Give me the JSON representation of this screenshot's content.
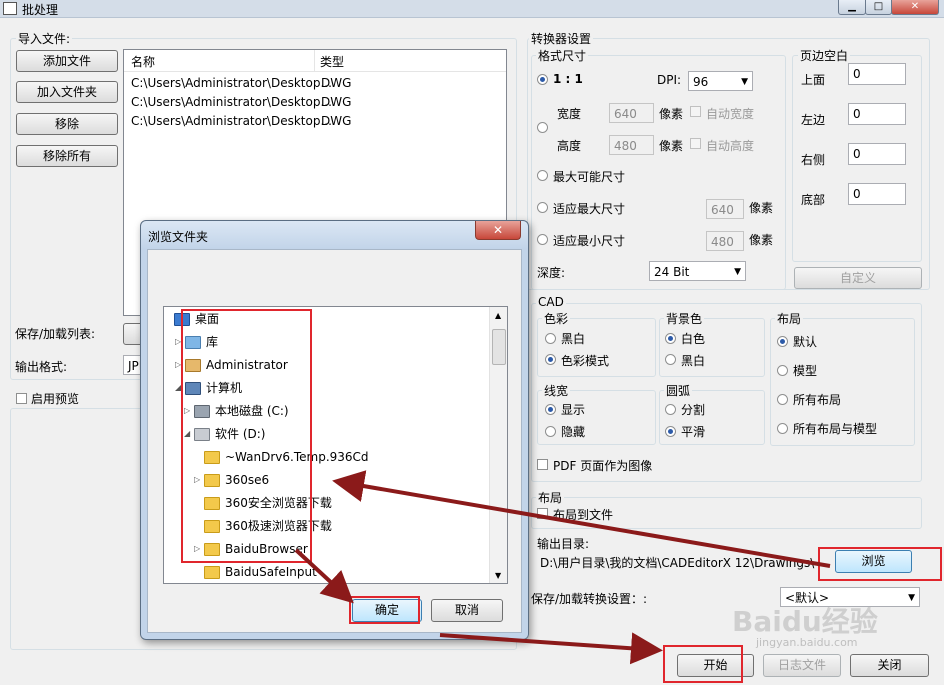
{
  "window": {
    "title": "批处理",
    "min": "▁",
    "max": "□",
    "close": "✕"
  },
  "import": {
    "group_label": "导入文件:",
    "buttons": {
      "add_file": "添加文件",
      "add_folder": "加入文件夹",
      "remove": "移除",
      "remove_all": "移除所有"
    },
    "columns": [
      "名称",
      "类型"
    ],
    "rows": [
      [
        "C:\\Users\\Administrator\\Desktop...",
        "DWG"
      ],
      [
        "C:\\Users\\Administrator\\Desktop...",
        "DWG"
      ],
      [
        "C:\\Users\\Administrator\\Desktop...",
        "DWG"
      ]
    ]
  },
  "left_bottom": {
    "save_load_list": "保存/加载列表:",
    "output_format": "输出格式:",
    "format_value": "JPI",
    "enable_preview": "启用预览"
  },
  "converter": {
    "group_label": "转换器设置",
    "format_size": {
      "label": "格式尺寸",
      "ratio_label": "1 : 1",
      "dpi_label": "DPI:",
      "dpi_value": "96",
      "width_label": "宽度",
      "width_value": "640",
      "height_label": "高度",
      "height_value": "480",
      "pixel_unit": "像素",
      "auto_width": "自动宽度",
      "auto_height": "自动高度",
      "max_possible": "最大可能尺寸",
      "fit_max": "适应最大尺寸",
      "fit_max_value": "640",
      "fit_min": "适应最小尺寸",
      "fit_min_value": "480",
      "depth_label": "深度:",
      "depth_value": "24 Bit"
    },
    "margins": {
      "label": "页边空白",
      "top_label": "上面",
      "top_value": "0",
      "left_label": "左边",
      "left_value": "0",
      "right_label": "右侧",
      "right_value": "0",
      "bottom_label": "底部",
      "bottom_value": "0",
      "custom_button": "自定义"
    }
  },
  "cad": {
    "label": "CAD",
    "color": {
      "label": "色彩",
      "options": [
        "黑白",
        "色彩模式"
      ],
      "selected": 1
    },
    "background": {
      "label": "背景色",
      "options": [
        "白色",
        "黑白"
      ],
      "selected": 0
    },
    "layout": {
      "label": "布局",
      "options": [
        "默认",
        "模型",
        "所有布局",
        "所有布局与模型"
      ],
      "selected": 0
    },
    "lineweight": {
      "label": "线宽",
      "options": [
        "显示",
        "隐藏"
      ],
      "selected": 0
    },
    "arc": {
      "label": "圆弧",
      "options": [
        "分割",
        "平滑"
      ],
      "selected": 1
    },
    "pdf_page_as_image": "PDF 页面作为图像"
  },
  "layout_section": {
    "label": "布局",
    "layout_to_file": "布局到文件"
  },
  "output": {
    "label": "输出目录:",
    "path": "D:\\用户目录\\我的文档\\CADEditorX 12\\Drawings\\",
    "browse_button": "浏览"
  },
  "save_load_settings": {
    "label": "保存/加载转换设置：:",
    "value": "<默认>"
  },
  "footer": {
    "start": "开始",
    "log": "日志文件",
    "close": "关闭"
  },
  "dialog": {
    "title": "浏览文件夹",
    "close": "✕",
    "tree": [
      {
        "label": "桌面",
        "level": 0,
        "icon": "desktop-icon"
      },
      {
        "label": "库",
        "level": 1,
        "icon": "library-icon",
        "expander": "▷"
      },
      {
        "label": "Administrator",
        "level": 1,
        "icon": "user-icon",
        "expander": "▷"
      },
      {
        "label": "计算机",
        "level": 1,
        "icon": "computer-icon",
        "expander": "◢"
      },
      {
        "label": "本地磁盘 (C:)",
        "level": 2,
        "icon": "drive-c-icon",
        "expander": "▷"
      },
      {
        "label": "软件 (D:)",
        "level": 2,
        "icon": "drive-d-icon",
        "expander": "◢"
      },
      {
        "label": "~WanDrv6.Temp.936Cd",
        "level": 3,
        "icon": "folder-icon"
      },
      {
        "label": "360se6",
        "level": 3,
        "icon": "folder-icon",
        "expander": "▷"
      },
      {
        "label": "360安全浏览器下载",
        "level": 3,
        "icon": "folder-icon"
      },
      {
        "label": "360极速浏览器下载",
        "level": 3,
        "icon": "folder-icon"
      },
      {
        "label": "BaiduBrowser",
        "level": 3,
        "icon": "folder-icon",
        "expander": "▷"
      },
      {
        "label": "BaiduSafeInput",
        "level": 3,
        "icon": "folder-icon"
      }
    ],
    "ok": "确定",
    "cancel": "取消"
  },
  "watermark": {
    "brand": "Baidu经验",
    "url": "jingyan.baidu.com"
  },
  "colors": {
    "highlight": "#e0262d",
    "arrow": "#8b1a1a",
    "accent": "#2c5aa8"
  }
}
